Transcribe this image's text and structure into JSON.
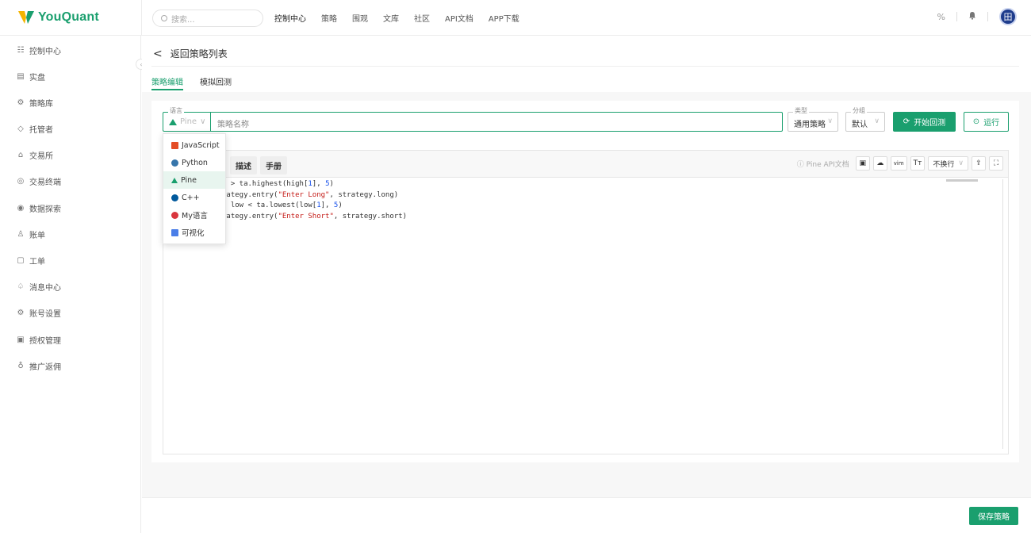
{
  "app": {
    "logo_text": "YouQuant"
  },
  "search": {
    "placeholder": "搜索..."
  },
  "nav": {
    "items": [
      "控制中心",
      "策略",
      "围观",
      "文库",
      "社区",
      "API文档",
      "APP下载"
    ]
  },
  "top_right": {
    "avatar_text": "田"
  },
  "sidebar": {
    "items": [
      {
        "label": "控制中心",
        "icon": "dashboard-icon",
        "glyph": "☷"
      },
      {
        "label": "实盘",
        "icon": "live-icon",
        "glyph": "▤"
      },
      {
        "label": "策略库",
        "icon": "strategy-icon",
        "glyph": "⚙"
      },
      {
        "label": "托管者",
        "icon": "docker-icon",
        "glyph": "◇"
      },
      {
        "label": "交易所",
        "icon": "exchange-icon",
        "glyph": "⌂"
      },
      {
        "label": "交易终端",
        "icon": "terminal-icon",
        "glyph": "◎"
      },
      {
        "label": "数据探索",
        "icon": "data-icon",
        "glyph": "◉"
      },
      {
        "label": "账单",
        "icon": "bill-icon",
        "glyph": "♙"
      },
      {
        "label": "工单",
        "icon": "ticket-icon",
        "glyph": "▢"
      },
      {
        "label": "消息中心",
        "icon": "bell-icon",
        "glyph": "♤"
      },
      {
        "label": "账号设置",
        "icon": "settings-icon",
        "glyph": "⚙"
      },
      {
        "label": "授权管理",
        "icon": "auth-icon",
        "glyph": "▣"
      },
      {
        "label": "推广返佣",
        "icon": "promo-icon",
        "glyph": "♁"
      }
    ]
  },
  "page": {
    "back_label": "返回策略列表",
    "tabs": [
      "策略编辑",
      "模拟回测"
    ]
  },
  "form": {
    "language_legend": "语言",
    "language_value": "Pine",
    "name_placeholder": "策略名称",
    "type_legend": "类型",
    "type_value": "通用策略",
    "group_legend": "分组",
    "group_value": "默认",
    "backtest_button": "开始回测",
    "run_button": "运行"
  },
  "language_dropdown": {
    "options": [
      {
        "label": "JavaScript",
        "color": "#e44d26",
        "selected": false
      },
      {
        "label": "Python",
        "color": "#3776ab",
        "selected": false
      },
      {
        "label": "Pine",
        "color": "#1a9f6e",
        "selected": true
      },
      {
        "label": "C++",
        "color": "#00599c",
        "selected": false
      },
      {
        "label": "My语言",
        "color": "#d9363e",
        "selected": false
      },
      {
        "label": "可视化",
        "color": "#4a7ee8",
        "selected": false
      }
    ]
  },
  "editor": {
    "tabs": [
      "描述",
      "手册"
    ],
    "api_doc_label": "Pine API文档",
    "wrap_label": "不换行",
    "vim_label": "vim",
    "font_label": "Tт",
    "code_lines": [
      "h > ta.highest(high[1], 5)",
      "rategy.entry(\"Enter Long\", strategy.long)",
      "f low < ta.lowest(low[1], 5)",
      "rategy.entry(\"Enter Short\", strategy.short)"
    ]
  },
  "footer": {
    "save_button": "保存策略"
  },
  "colors": {
    "accent": "#1a9f6e"
  }
}
